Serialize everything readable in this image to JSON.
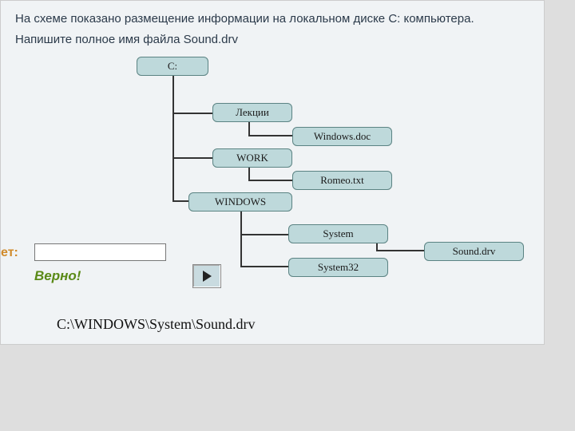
{
  "instruction": "На схеме показано размещение информации на локальном диске С: компьютера. Напишите полное имя файла Sound.drv",
  "tree": {
    "root": "C:",
    "lektsii": "Лекции",
    "windows_doc": "Windows.doc",
    "work": "WORK",
    "romeo_txt": "Romeo.txt",
    "windows": "WINDOWS",
    "system": "System",
    "sound_drv": "Sound.drv",
    "system32": "System32"
  },
  "answer_label": "ет:",
  "answer_value": "",
  "feedback": "Верно!",
  "solution": "C:\\WINDOWS\\System\\Sound.drv"
}
